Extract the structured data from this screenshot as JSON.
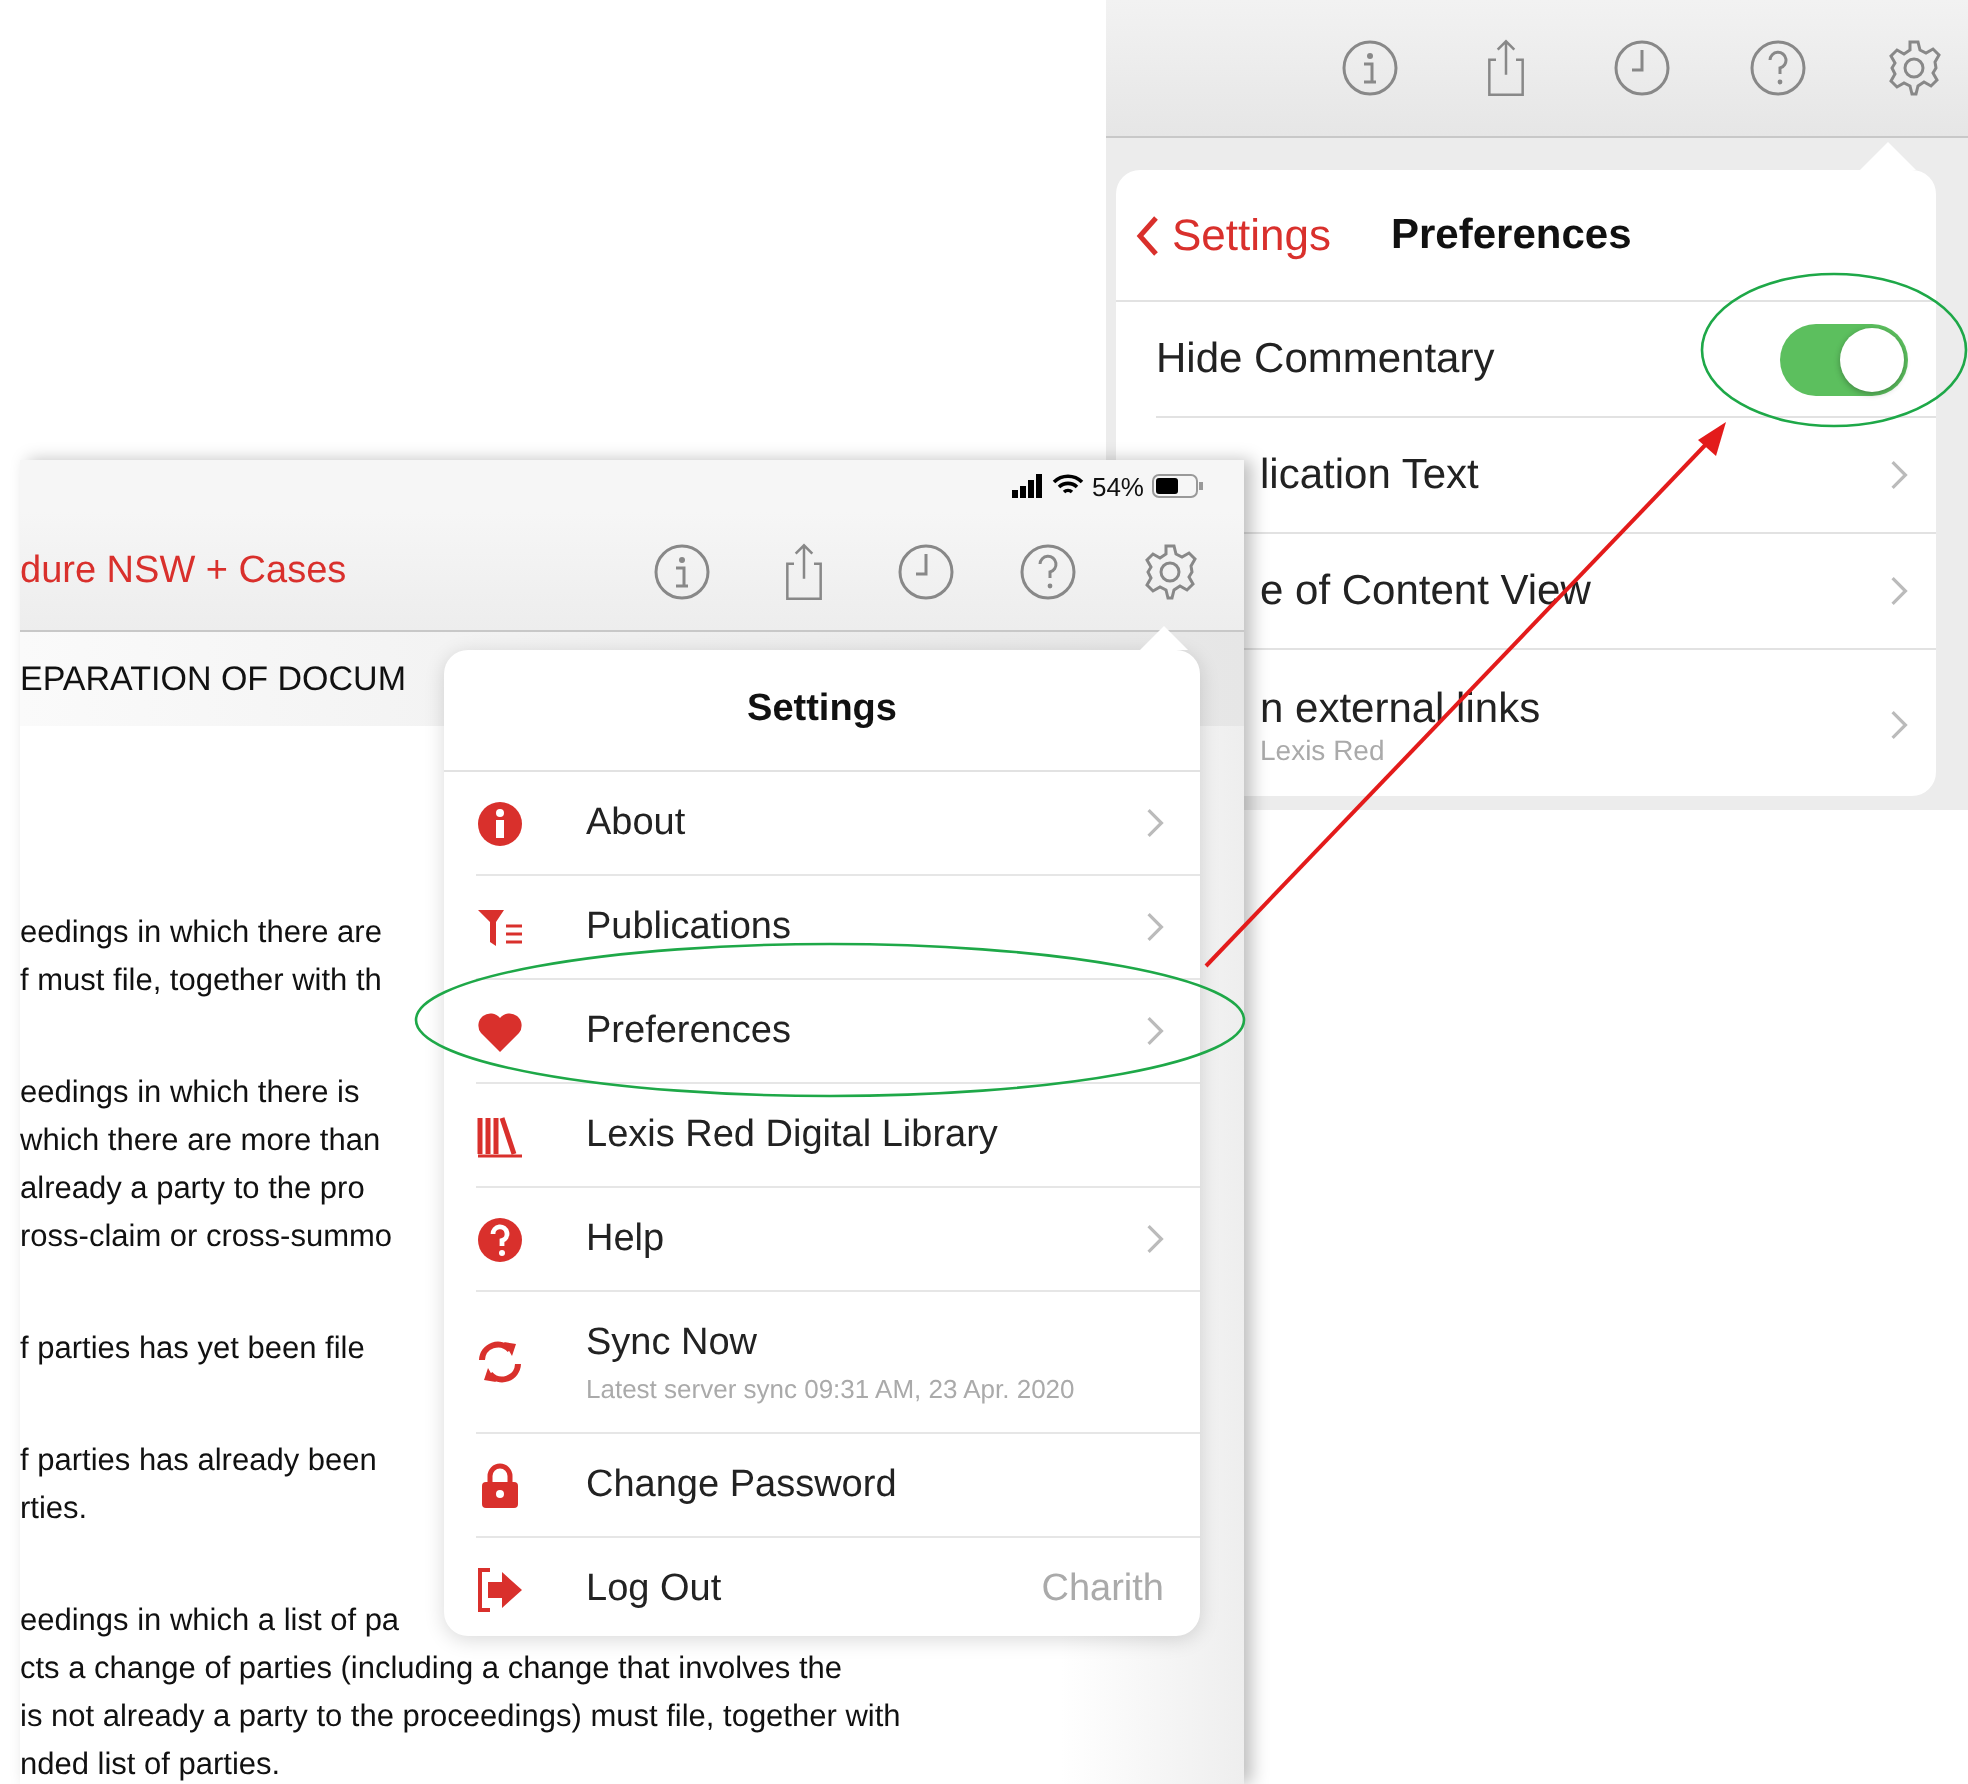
{
  "preferences_screen": {
    "back": "Settings",
    "title": "Preferences",
    "rows": [
      {
        "kind": "toggle",
        "label": "Hide Commentary",
        "on": true
      },
      {
        "kind": "link",
        "label": "lication Text"
      },
      {
        "kind": "link",
        "label": "e of Content View"
      },
      {
        "kind": "link",
        "label": "n external links",
        "subtitle": "Lexis Red"
      }
    ]
  },
  "document_screen": {
    "status": {
      "battery": "54%"
    },
    "title": "dure NSW + Cases",
    "heading": "EPARATION OF DOCUM",
    "paragraphs": [
      [
        "eedings in which there are",
        "f must file, together with th"
      ],
      [
        "eedings in which there is",
        "which there are more than",
        "already a party to the pro",
        "ross-claim or cross-summo"
      ],
      [
        "f parties has yet been file"
      ],
      [
        "f parties has already been",
        "rties."
      ],
      [
        "eedings in which a list of pa",
        "cts a change of parties (including a change that involves the",
        "is not already a party to the proceedings) must file, together with",
        "nded list of parties."
      ]
    ],
    "settings_menu": {
      "title": "Settings",
      "items": [
        {
          "kind": "info",
          "label": "About",
          "chevron": true
        },
        {
          "kind": "publications",
          "label": "Publications",
          "chevron": true
        },
        {
          "kind": "preferences",
          "label": "Preferences",
          "chevron": true
        },
        {
          "kind": "library",
          "label": "Lexis Red Digital Library",
          "chevron": false
        },
        {
          "kind": "help",
          "label": "Help",
          "chevron": true
        },
        {
          "kind": "sync",
          "label": "Sync Now",
          "subtitle": "Latest server sync 09:31 AM, 23 Apr. 2020",
          "chevron": false
        },
        {
          "kind": "password",
          "label": "Change Password",
          "chevron": false
        },
        {
          "kind": "logout",
          "label": "Log Out",
          "value": "Charith",
          "chevron": false
        }
      ]
    }
  }
}
